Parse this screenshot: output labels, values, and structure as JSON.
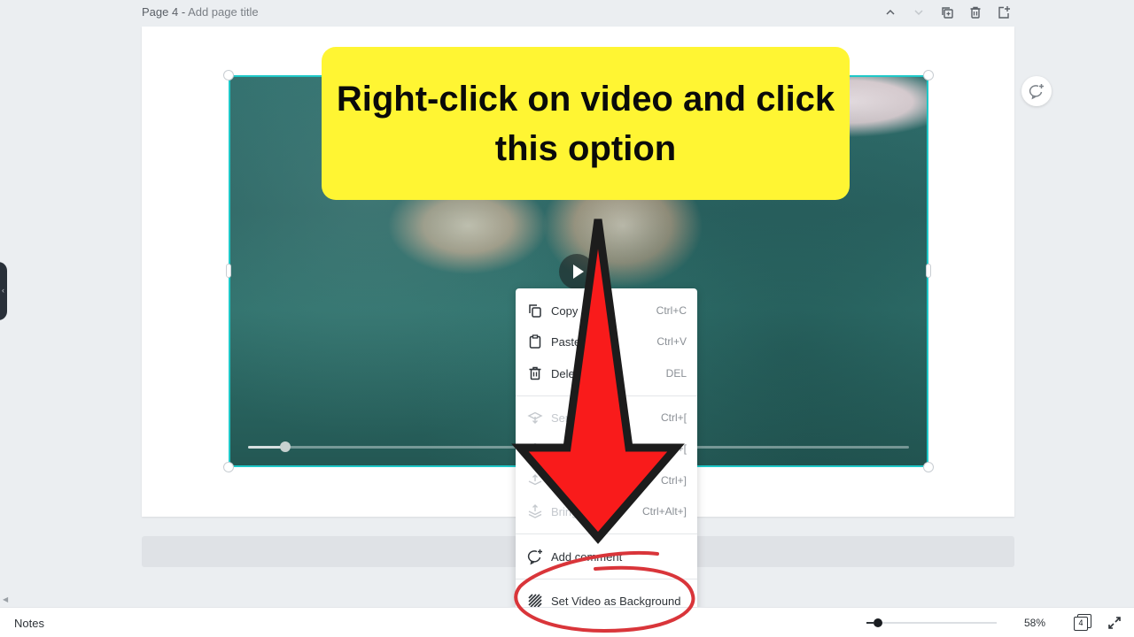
{
  "page_header": {
    "page_label": "Page 4 -",
    "title_placeholder": "Add page title",
    "icons": [
      "chevron-up-icon",
      "chevron-down-icon",
      "duplicate-page-icon",
      "delete-page-icon",
      "add-page-icon"
    ]
  },
  "video": {
    "play_icon": "play-icon",
    "progress_fraction": 0.056
  },
  "context_menu": {
    "items": [
      {
        "icon": "copy-icon",
        "label": "Copy",
        "shortcut": "Ctrl+C",
        "enabled": true
      },
      {
        "icon": "paste-icon",
        "label": "Paste",
        "shortcut": "Ctrl+V",
        "enabled": true
      },
      {
        "icon": "delete-icon",
        "label": "Delete",
        "shortcut": "DEL",
        "enabled": true
      },
      {
        "icon": "send-to-back-icon",
        "label": "Send to back",
        "shortcut": "Ctrl+[",
        "enabled": false
      },
      {
        "icon": "send-backward-icon",
        "label": "Send backward",
        "shortcut": "Ctrl+[",
        "enabled": false
      },
      {
        "icon": "bring-forward-icon",
        "label": "Bring forward",
        "shortcut": "Ctrl+]",
        "enabled": false
      },
      {
        "icon": "bring-to-front-icon",
        "label": "Bring to front",
        "shortcut": "Ctrl+Alt+]",
        "enabled": false
      },
      {
        "icon": "add-comment-icon",
        "label": "Add comment",
        "shortcut": "",
        "enabled": true
      },
      {
        "icon": "set-background-icon",
        "label": "Set Video as Background",
        "shortcut": "",
        "enabled": true
      }
    ]
  },
  "bottom_bar": {
    "notes_label": "Notes",
    "zoom_percent": "58%",
    "zoom_fraction": 0.02,
    "page_count": "4"
  },
  "annotation": {
    "callout_text": "Right-click on video and click this option",
    "callout_color": "#fff533",
    "arrow_color": "#f91b1b",
    "circle_color": "#d9353a"
  },
  "colors": {
    "selection": "#1fc8c8",
    "background": "#ebeef1"
  }
}
